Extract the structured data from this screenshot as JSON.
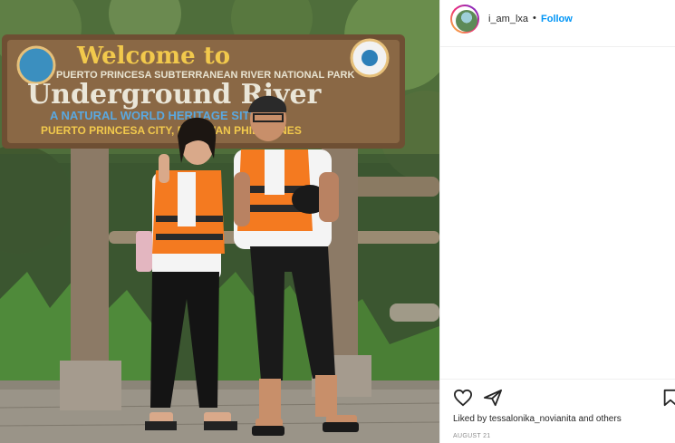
{
  "post": {
    "username": "i_am_lxa",
    "separator": "•",
    "follow_label": "Follow",
    "liked_prefix": "Liked by",
    "liked_user": "tessalonika_novianita",
    "liked_conjunction": "and",
    "liked_others": "others",
    "date": "AUGUST 21"
  },
  "photo": {
    "sign_line1": "Welcome to",
    "sign_line2": "PUERTO PRINCESA SUBTERRANEAN RIVER NATIONAL PARK",
    "sign_line3": "Underground River",
    "sign_line4": "A NATURAL WORLD HERITAGE SITE",
    "sign_line5": "PUERTO PRINCESA CITY, PALAWAN PHILIPPINES"
  },
  "icons": {
    "like": "heart-icon",
    "comment": "comment-icon",
    "save": "bookmark-icon"
  },
  "colors": {
    "follow": "#0095f6",
    "text": "#262626",
    "muted": "#8e8e8e",
    "sign_wood": "#7a5a3a",
    "vest": "#f47a20"
  }
}
